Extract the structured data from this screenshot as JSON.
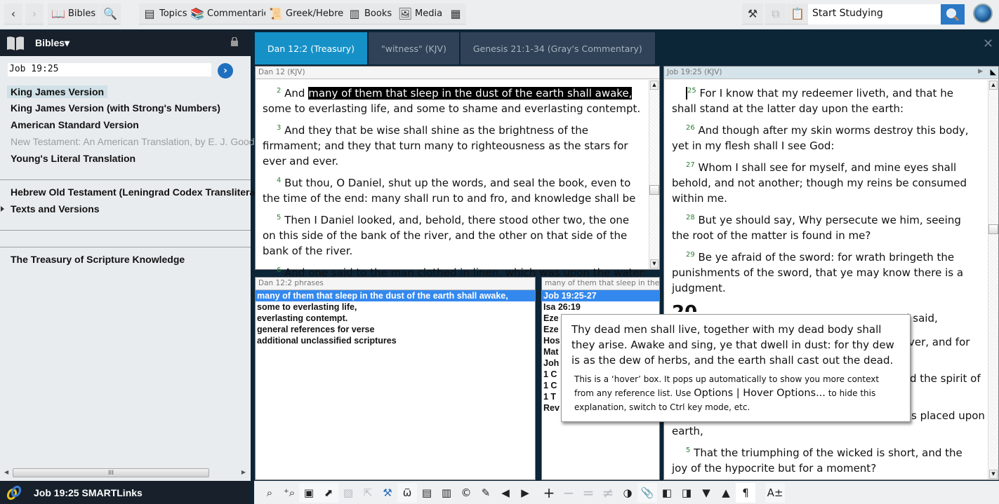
{
  "toolbar": {
    "back_icon": "chevron-left",
    "forward_icon": "chevron-right",
    "buttons": [
      {
        "label": "Bibles",
        "icon": "bible-book-icon"
      },
      {
        "label": "",
        "icon": "bible-search-icon"
      },
      {
        "label": "Topics",
        "icon": "topics-icon"
      },
      {
        "label": "Commentaries",
        "icon": "commentaries-icon"
      },
      {
        "label": "Greek/Hebrew",
        "icon": "scroll-icon"
      },
      {
        "label": "Books",
        "icon": "books-icon"
      },
      {
        "label": "Media",
        "icon": "media-icon"
      },
      {
        "label": "",
        "icon": "layout-icon"
      }
    ],
    "tools_icon": "hammer-wrench",
    "copy_icon": "copy",
    "notes_icon": "clipboard-pen",
    "search_value": "Start Studying",
    "search_icon": "magnifier",
    "logo_icon": "globe-logo"
  },
  "left_panel": {
    "title": "Bibles▾",
    "reference_value": "Job 19:25",
    "go_label": "›",
    "items": [
      {
        "label": "King James Version",
        "selected": true,
        "enabled": true
      },
      {
        "label": "King James Version (with Strong's Numbers)",
        "enabled": true
      },
      {
        "label": "American Standard Version",
        "enabled": true
      },
      {
        "label": "New Testament: An American Translation, by E. J. Goodspeed",
        "enabled": false
      },
      {
        "label": "Young's Literal Translation",
        "enabled": true
      },
      {
        "label": "Hebrew Old Testament (Leningrad Codex Transliterated)",
        "enabled": true
      },
      {
        "label": "Texts and Versions",
        "enabled": true,
        "expandable": true
      },
      {
        "label": "The Treasury of Scripture Knowledge",
        "enabled": true
      }
    ],
    "footer_title": "Job 19:25 SMARTLinks"
  },
  "tabs": [
    {
      "label": "Dan 12:2 (Treasury)",
      "active": true
    },
    {
      "label": "\"witness\" (KJV)",
      "active": false
    },
    {
      "label": "Genesis 21:1-34 (Gray's Commentary)",
      "active": false
    }
  ],
  "dan_pane": {
    "header": "Dan 12 (KJV)",
    "verses": [
      {
        "num": "2",
        "pre": "And ",
        "highlight": "many of them that sleep in the dust of the earth shall awake,",
        "post": " some to everlasting life, and some to shame and everlasting contempt."
      },
      {
        "num": "3",
        "text": "And they that be wise shall shine as the brightness of the firmament; and they that turn many to righteousness as the stars for ever and ever."
      },
      {
        "num": "4",
        "text": "But thou, O Daniel, shut up the words, and seal the book, even to the time of the end: many shall run to and fro, and knowledge shall be increased."
      },
      {
        "num": "5",
        "text": "Then I Daniel looked, and, behold, there stood other two, the one on this side of the bank of the river, and the other on that side of the bank of the river."
      },
      {
        "num": "6",
        "text": "And one said to the man clothed in linen, which was upon the waters of"
      }
    ]
  },
  "phrases_pane": {
    "header": "Dan 12:2 phrases",
    "items": [
      "many of them that sleep in the dust of the earth shall awake,",
      "some to everlasting life,",
      "everlasting contempt.",
      "general references for verse",
      "additional unclassified scriptures"
    ]
  },
  "refs_pane": {
    "header": "many of them that sleep in the dust of the earth shall awake,",
    "items": [
      "Job 19:25-27",
      "Isa 26:19",
      "Eze",
      "Eze",
      "Hos",
      "Mat",
      "Joh",
      "1 C",
      "1 C",
      "1 T",
      "Rev"
    ]
  },
  "job_pane": {
    "header": "Job 19:25 (KJV)",
    "verses": [
      {
        "num": "25",
        "text": "For I know that my redeemer liveth, and that he shall stand at the latter day upon the earth:"
      },
      {
        "num": "26",
        "text": "And though after my skin worms destroy this body, yet in my flesh shall I see God:"
      },
      {
        "num": "27",
        "text": "Whom I shall see for myself, and mine eyes shall behold, and not another; though my reins be consumed within me."
      },
      {
        "num": "28",
        "text": "But ye should say, Why persecute we him, seeing the root of the matter is found in me?"
      },
      {
        "num": "29",
        "text": "Be ye afraid of the sword: for wrath bringeth the punishments of the sword, that ye may know there is a judgment."
      }
    ],
    "chapter_heading": "20",
    "partial_lines": [
      "d said,",
      "ver, and for",
      "d the spirit of",
      "s placed upon",
      "earth,"
    ],
    "verse5": {
      "num": "5",
      "text": "That the triumphing of the wicked is short, and the joy of the hypocrite but for a moment?"
    }
  },
  "hover_box": {
    "verse_text": "Thy dead men shall live, together with my dead body shall they arise. Awake and sing, ye that dwell in dust: for thy dew is as the dew of herbs, and the earth shall cast out the dead.",
    "note_1": "This is a ‘hover’ box.  It pops up automatically to show you more context from any reference list.  Use ",
    "note_link": "Options | Hover Options...",
    "note_2": " to hide this explanation, switch to Ctrl key mode, etc."
  },
  "bottom_toolbar": {
    "icons": [
      "search",
      "zoom-in-search",
      "quick-search",
      "open-external",
      "link-dim",
      "pointer-dim",
      "tools",
      "word-count",
      "book-prev",
      "book-next",
      "copyright",
      "highlight",
      "prev",
      "next",
      "plus",
      "minus-dim",
      "equal-dim",
      "not-equal-dim",
      "contrast",
      "paperclip",
      "page-prev",
      "page-next",
      "down",
      "up",
      "paragraph",
      "text-size"
    ]
  }
}
